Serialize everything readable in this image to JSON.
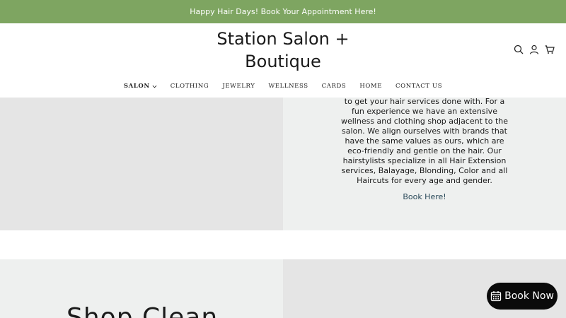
{
  "announcement": "Happy Hair Days! Book Your Appointment Here!",
  "logo": "Station Salon + Boutique",
  "header_icons": [
    "search-icon",
    "account-icon",
    "cart-icon"
  ],
  "nav": {
    "items": [
      {
        "label": "SALON",
        "active": true,
        "has_dropdown": true
      },
      {
        "label": "CLOTHING"
      },
      {
        "label": "JEWELRY"
      },
      {
        "label": "WELLNESS"
      },
      {
        "label": "CARDS"
      },
      {
        "label": "HOME"
      },
      {
        "label": "CONTACT US"
      }
    ]
  },
  "about": {
    "text": "to get your hair services done with. For a fun experience we have an extensive wellness and clothing shop adjacent to the salon. We align ourselves with brands that have the same values as ours, which are eco-friendly and gentle on the hair. Our hairstylists specialize in all Hair Extension services, Balayage, Blonding, Color and all Haircuts for every age and gender.",
    "link": "Book Here!"
  },
  "shop_section": {
    "heading": "Shop Clean"
  },
  "book_now_button": "Book Now",
  "colors": {
    "announcement_bg": "#7ea561",
    "book_now_bg": "#0a0a0a",
    "panel_light": "#eef0ef",
    "panel_gray": "#e5e5e5"
  }
}
